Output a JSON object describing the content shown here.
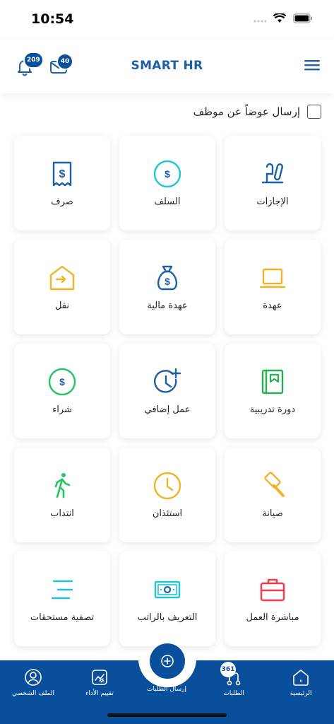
{
  "status_bar": {
    "time": "10:54"
  },
  "header": {
    "title": "SMART HR",
    "notifications_count": "209",
    "messages_count": "40"
  },
  "behalf": {
    "label": "إرسال عوضاً عن موظف"
  },
  "services": [
    {
      "label": "الإجازات",
      "icon": "leave-icon",
      "color": "#1f5fa5"
    },
    {
      "label": "السلف",
      "icon": "dollar-circle-icon",
      "color": "#20c5d8"
    },
    {
      "label": "صرف",
      "icon": "receipt-icon",
      "color": "#1f5fa5"
    },
    {
      "label": "عهدة",
      "icon": "laptop-icon",
      "color": "#f0b429"
    },
    {
      "label": "عهدة مالية",
      "icon": "money-bag-icon",
      "color": "#1f5fa5"
    },
    {
      "label": "نقل",
      "icon": "transfer-icon",
      "color": "#f0b429"
    },
    {
      "label": "دورة تدريبية",
      "icon": "notebook-icon",
      "color": "#22b14c"
    },
    {
      "label": "عمل إضافي",
      "icon": "clock-plus-icon",
      "color": "#1f5fa5"
    },
    {
      "label": "شراء",
      "icon": "dollar-circle-icon",
      "color": "#22c55e"
    },
    {
      "label": "صيانة",
      "icon": "hammer-icon",
      "color": "#f0b429"
    },
    {
      "label": "استئذان",
      "icon": "clock-icon",
      "color": "#f0b429"
    },
    {
      "label": "انتداب",
      "icon": "walking-person-icon",
      "color": "#22c55e"
    },
    {
      "label": "مباشرة العمل",
      "icon": "briefcase-icon",
      "color": "#ef3b4c"
    },
    {
      "label": "التعريف بالراتب",
      "icon": "cash-icon",
      "color": "#20c5d8"
    },
    {
      "label": "تصفية مستحقات",
      "icon": "lines-icon",
      "color": "#20c5d8"
    }
  ],
  "bottom_nav": {
    "home": "الرئيسية",
    "requests": "الطلبات",
    "requests_count": "361",
    "send_requests": "إرسال الطلبات",
    "performance": "تقييم الأداء",
    "profile": "الملف الشخصي"
  }
}
